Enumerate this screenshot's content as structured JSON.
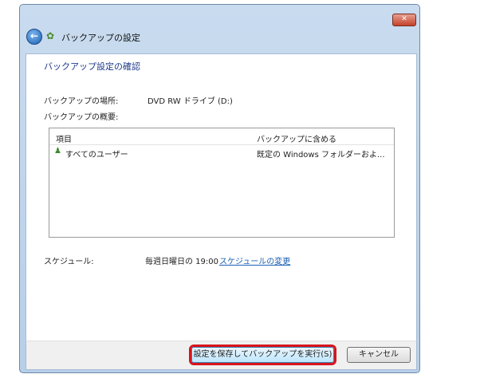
{
  "window": {
    "title": "バックアップの設定",
    "close_label": "✕"
  },
  "content": {
    "heading": "バックアップ設定の確認",
    "location_label": "バックアップの場所:",
    "location_value": "DVD RW ドライブ (D:)",
    "summary_label": "バックアップの概要:",
    "list": {
      "columns": [
        "項目",
        "バックアップに含める"
      ],
      "rows": [
        {
          "item": "すべてのユーザー",
          "include": "既定の Windows フォルダーおよ..."
        }
      ]
    },
    "schedule_label": "スケジュール:",
    "schedule_value": "毎週日曜日の 19:00",
    "schedule_link": "スケジュールの変更"
  },
  "footer": {
    "save_run_label": "設定を保存してバックアップを実行(S)",
    "cancel_label": "キャンセル"
  },
  "colors": {
    "highlight": "#d9141b",
    "link": "#1a5fb4"
  }
}
